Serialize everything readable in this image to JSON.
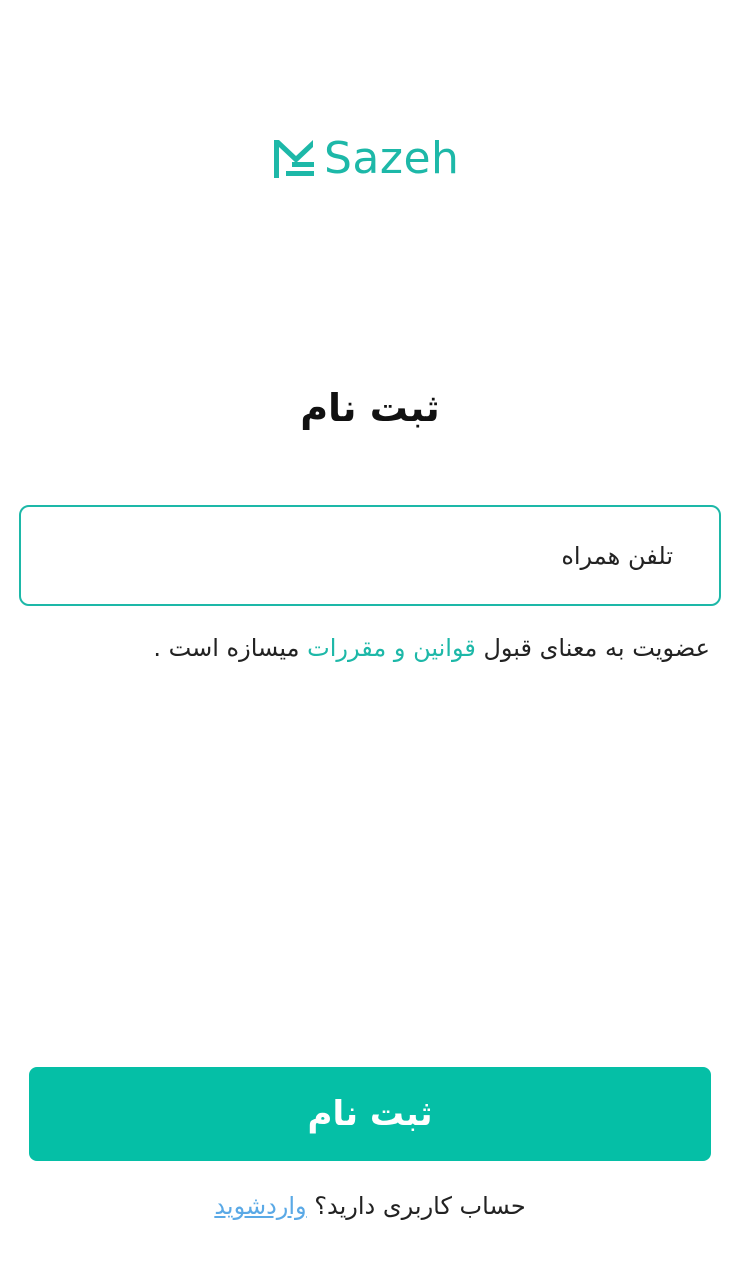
{
  "brand": {
    "name": "Sazeh",
    "logo_icon": "sazeh-logo-mark",
    "color": "#1db8a8"
  },
  "signup": {
    "title": "ثبت نام",
    "phone_placeholder": "تلفن همراه",
    "terms_before": "عضویت به معنای قبول ",
    "terms_link": "قوانین و مقررات",
    "terms_after": " میسازه است .",
    "submit_label": "ثبت نام",
    "login_prompt": "حساب کاربری دارید؟",
    "login_link": "واردشوید"
  },
  "colors": {
    "accent": "#1db8a8",
    "button": "#05bfa6",
    "link": "#5aa9e6"
  }
}
